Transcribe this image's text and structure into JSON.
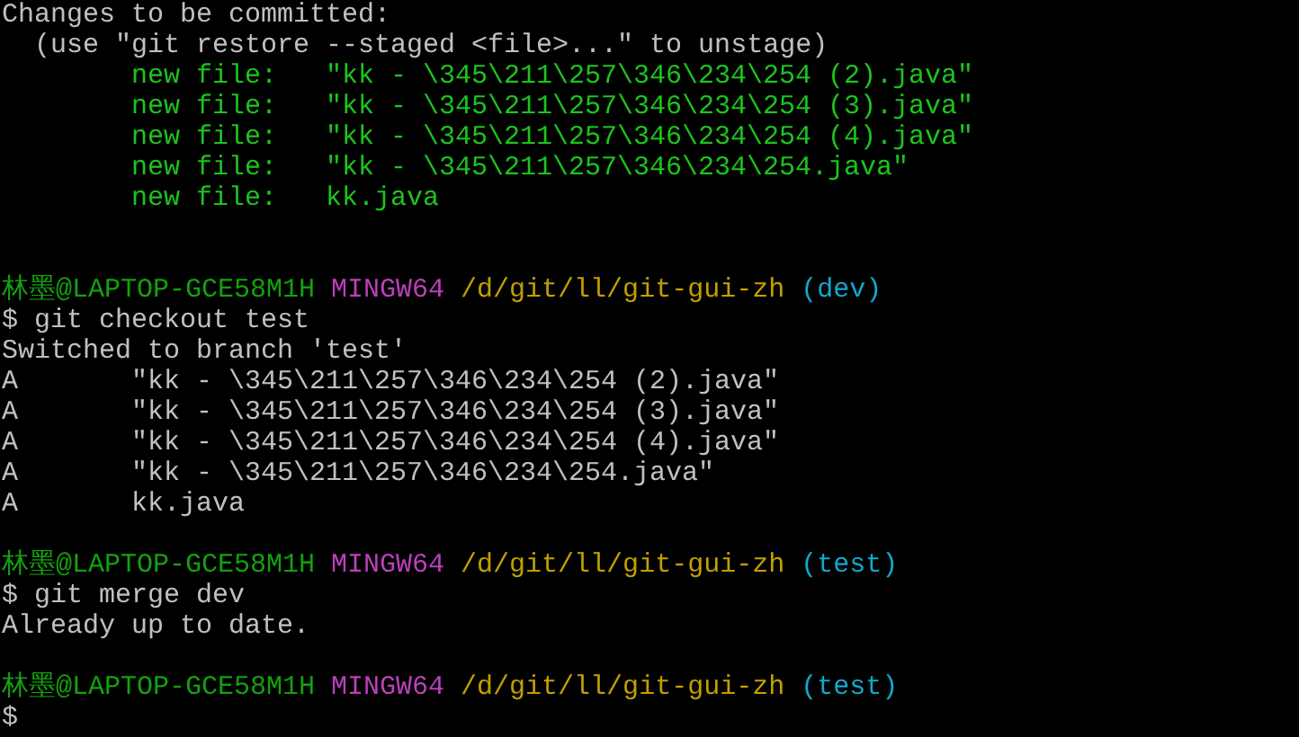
{
  "terminal": {
    "lines": [
      {
        "kind": "text",
        "text": "Changes to be committed:"
      },
      {
        "kind": "hint",
        "text": "(use \"git restore --staged <file>...\" to unstage)"
      },
      {
        "kind": "staged",
        "label": "new file:",
        "file": "\"kk - \\345\\211\\257\\346\\234\\254 (2).java\""
      },
      {
        "kind": "staged",
        "label": "new file:",
        "file": "\"kk - \\345\\211\\257\\346\\234\\254 (3).java\""
      },
      {
        "kind": "staged",
        "label": "new file:",
        "file": "\"kk - \\345\\211\\257\\346\\234\\254 (4).java\""
      },
      {
        "kind": "staged",
        "label": "new file:",
        "file": "\"kk - \\345\\211\\257\\346\\234\\254.java\""
      },
      {
        "kind": "staged",
        "label": "new file:",
        "file": "kk.java"
      },
      {
        "kind": "blank"
      },
      {
        "kind": "blank"
      },
      {
        "kind": "prompt",
        "user": "林墨@LAPTOP-GCE58M1H",
        "system": "MINGW64",
        "path": "/d/git/ll/git-gui-zh",
        "branch": "(dev)"
      },
      {
        "kind": "command",
        "sign": "$",
        "command": "git checkout test"
      },
      {
        "kind": "text",
        "text": "Switched to branch 'test'"
      },
      {
        "kind": "status",
        "code": "A",
        "file": "\"kk - \\345\\211\\257\\346\\234\\254 (2).java\""
      },
      {
        "kind": "status",
        "code": "A",
        "file": "\"kk - \\345\\211\\257\\346\\234\\254 (3).java\""
      },
      {
        "kind": "status",
        "code": "A",
        "file": "\"kk - \\345\\211\\257\\346\\234\\254 (4).java\""
      },
      {
        "kind": "status",
        "code": "A",
        "file": "\"kk - \\345\\211\\257\\346\\234\\254.java\""
      },
      {
        "kind": "status",
        "code": "A",
        "file": "kk.java"
      },
      {
        "kind": "blank"
      },
      {
        "kind": "prompt",
        "user": "林墨@LAPTOP-GCE58M1H",
        "system": "MINGW64",
        "path": "/d/git/ll/git-gui-zh",
        "branch": "(test)"
      },
      {
        "kind": "command",
        "sign": "$",
        "command": "git merge dev"
      },
      {
        "kind": "text",
        "text": "Already up to date."
      },
      {
        "kind": "blank"
      },
      {
        "kind": "prompt",
        "user": "林墨@LAPTOP-GCE58M1H",
        "system": "MINGW64",
        "path": "/d/git/ll/git-gui-zh",
        "branch": "(test)"
      },
      {
        "kind": "command",
        "sign": "$"
      }
    ]
  }
}
